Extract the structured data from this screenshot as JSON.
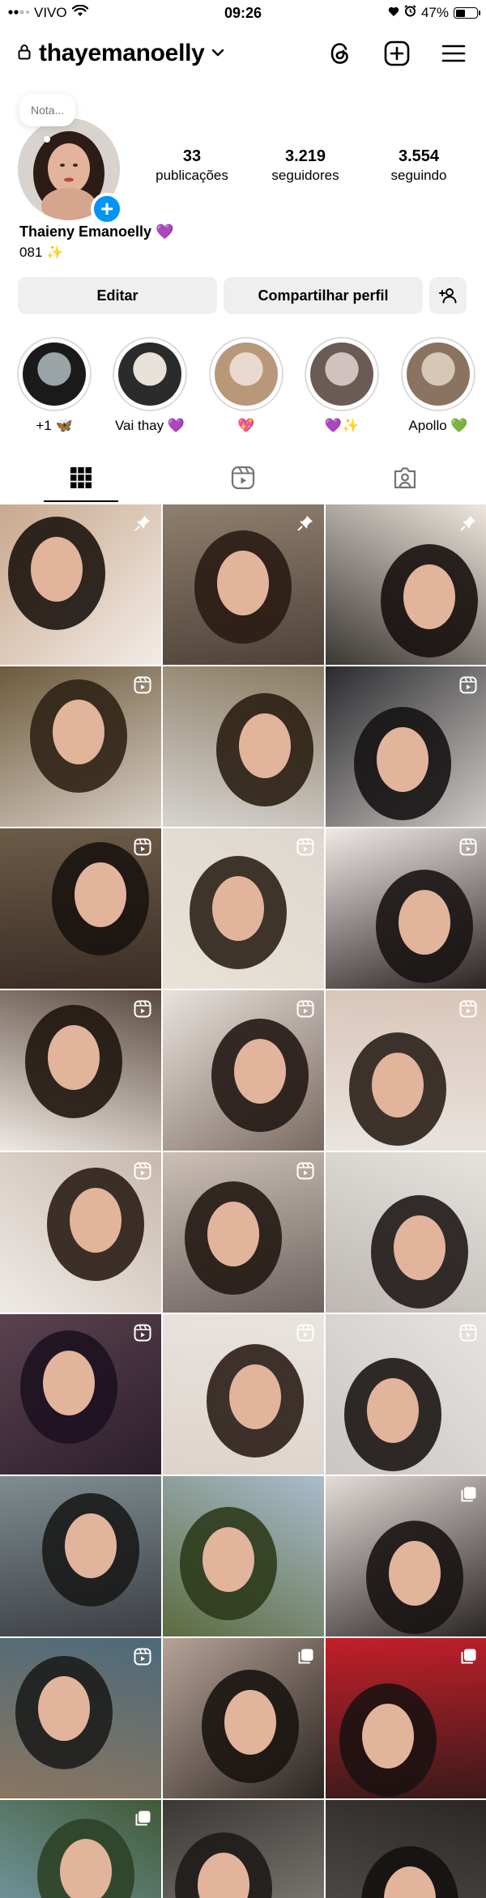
{
  "status_bar": {
    "carrier": "VIVO",
    "time": "09:26",
    "battery": "47%",
    "battery_level": 0.47
  },
  "header": {
    "username": "thayemanoelly"
  },
  "profile": {
    "note_placeholder": "Nota...",
    "stats": [
      {
        "value": "33",
        "label": "publicações"
      },
      {
        "value": "3.219",
        "label": "seguidores"
      },
      {
        "value": "3.554",
        "label": "seguindo"
      }
    ],
    "full_name": "Thaieny Emanoelly 💜",
    "bio": "081 ✨"
  },
  "actions": {
    "edit": "Editar",
    "share": "Compartilhar perfil"
  },
  "highlights": [
    {
      "label": "+1 🦋",
      "colors": [
        "#1a1a1a",
        "#9aa3a6"
      ]
    },
    {
      "label": "Vai thay 💜",
      "colors": [
        "#2b2b2b",
        "#e8e1da"
      ]
    },
    {
      "label": "💖",
      "colors": [
        "#b99779",
        "#e9d9cf"
      ]
    },
    {
      "label": "💜✨",
      "colors": [
        "#6a5b55",
        "#d1c2bf"
      ]
    },
    {
      "label": "Apollo 💚",
      "colors": [
        "#8a7361",
        "#d6c7b6"
      ]
    }
  ],
  "tabs": [
    "grid-tab",
    "reels-tab",
    "tagged-tab"
  ],
  "grid": [
    {
      "badge": "pin",
      "bg": [
        "#c9a88e",
        "#f2ece6"
      ],
      "hair": "#1c1410"
    },
    {
      "badge": "pin",
      "bg": [
        "#8f7f6e",
        "#4e4238"
      ],
      "hair": "#2a1c14"
    },
    {
      "badge": "pin",
      "bg": [
        "#efe7df",
        "#3b3733"
      ],
      "hair": "#17110e"
    },
    {
      "badge": "reel",
      "bg": [
        "#6e5a3d",
        "#d8d0c5"
      ],
      "hair": "#2f2416"
    },
    {
      "badge": "none",
      "bg": [
        "#8a7c63",
        "#d6d3d0"
      ],
      "hair": "#2a1f12"
    },
    {
      "badge": "reel",
      "bg": [
        "#2a2a2e",
        "#cfcac6"
      ],
      "hair": "#151313"
    },
    {
      "badge": "reel",
      "bg": [
        "#6d5b48",
        "#3a2d24"
      ],
      "hair": "#1a1310"
    },
    {
      "badge": "reel",
      "bg": [
        "#ded7cf",
        "#e9e2d6"
      ],
      "hair": "#2c2116"
    },
    {
      "badge": "reel",
      "bg": [
        "#efe9e6",
        "#2a2323"
      ],
      "hair": "#1a1414"
    },
    {
      "badge": "reel",
      "bg": [
        "#5a4a3f",
        "#eee8e2"
      ],
      "hair": "#1f1611"
    },
    {
      "badge": "reel",
      "bg": [
        "#e8e2dc",
        "#7a6a61"
      ],
      "hair": "#231a15"
    },
    {
      "badge": "reel",
      "bg": [
        "#d9c5b9",
        "#e9e3df"
      ],
      "hair": "#2a2019"
    },
    {
      "badge": "reel",
      "bg": [
        "#c7b8ac",
        "#eeeae6"
      ],
      "hair": "#2a1d15"
    },
    {
      "badge": "reel",
      "bg": [
        "#cbbfb5",
        "#6d6360"
      ],
      "hair": "#241a14"
    },
    {
      "badge": "none",
      "bg": [
        "#e6e2de",
        "#bcb7b3"
      ],
      "hair": "#1f1a18"
    },
    {
      "badge": "reel",
      "bg": [
        "#5c4250",
        "#2b1f29"
      ],
      "hair": "#1d1220"
    },
    {
      "badge": "reel",
      "bg": [
        "#e9e4df",
        "#ddd3cb"
      ],
      "hair": "#2b1e18"
    },
    {
      "badge": "reel",
      "bg": [
        "#e6e3e1",
        "#c9c5c2"
      ],
      "hair": "#1b1614"
    },
    {
      "badge": "none",
      "bg": [
        "#7f8c90",
        "#3c3f44"
      ],
      "hair": "#1a1a1a"
    },
    {
      "badge": "none",
      "bg": [
        "#a9bccd",
        "#5c6b3f"
      ],
      "hair": "#2d3b1c"
    },
    {
      "badge": "multi",
      "bg": [
        "#e3dcd8",
        "#2a2525"
      ],
      "hair": "#181313"
    },
    {
      "badge": "reel",
      "bg": [
        "#4c6a7a",
        "#8a7660"
      ],
      "hair": "#1d1d1d"
    },
    {
      "badge": "multi",
      "bg": [
        "#b6a398",
        "#2b2521"
      ],
      "hair": "#1a1411"
    },
    {
      "badge": "multi",
      "bg": [
        "#c21f2a",
        "#3a1a1a"
      ],
      "hair": "#1d1212"
    },
    {
      "badge": "multi",
      "bg": [
        "#3f5a36",
        "#7fa3b5"
      ],
      "hair": "#2e4227"
    },
    {
      "badge": "none",
      "bg": [
        "#3b3734",
        "#8e8984"
      ],
      "hair": "#1e1b19"
    },
    {
      "badge": "none",
      "bg": [
        "#2b2725",
        "#5a5552"
      ],
      "hair": "#141111"
    }
  ]
}
